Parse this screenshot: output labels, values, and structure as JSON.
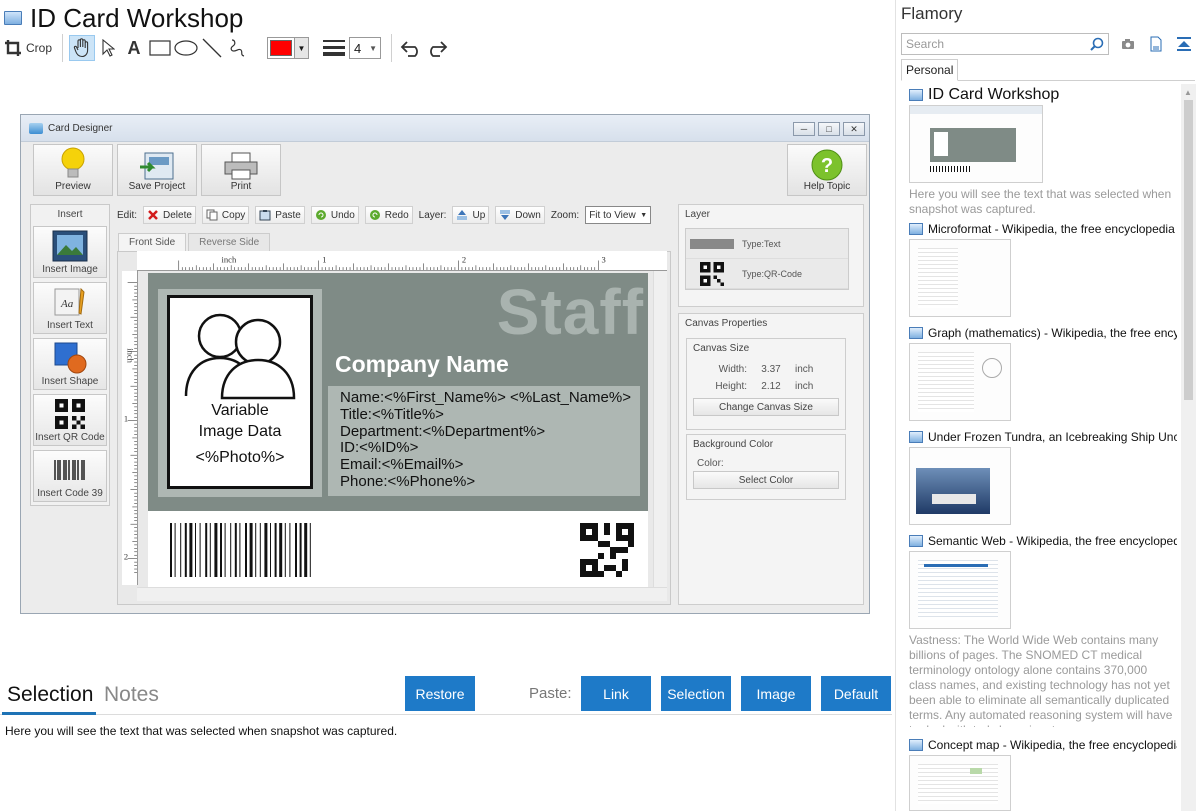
{
  "window": {
    "title": "ID Card Workshop"
  },
  "toolbar": {
    "crop_label": "Crop",
    "line_width": "4"
  },
  "snapshot": {
    "title": "Card Designer",
    "buttons": {
      "preview": "Preview",
      "save": "Save Project",
      "print": "Print",
      "help": "Help Topic"
    },
    "insert": {
      "header": "Insert",
      "items": [
        "Insert Image",
        "Insert Text",
        "Insert Shape",
        "Insert QR Code",
        "Insert Code 39"
      ]
    },
    "edit_bar": {
      "edit_label": "Edit:",
      "delete": "Delete",
      "copy": "Copy",
      "paste": "Paste",
      "undo": "Undo",
      "redo": "Redo",
      "layer_label": "Layer:",
      "up": "Up",
      "down": "Down",
      "zoom_label": "Zoom:",
      "zoom_value": "Fit to View"
    },
    "tabs": [
      "Front Side",
      "Reverse Side"
    ],
    "ruler": {
      "unit": "inch",
      "h_marks": [
        "1",
        "2",
        "3"
      ],
      "v_marks": [
        "1",
        "2"
      ]
    },
    "card": {
      "watermark": "Staff",
      "company": "Company Name",
      "photo": [
        "Variable",
        "Image Data",
        "<%Photo%>"
      ],
      "fields": [
        "Name:<%First_Name%> <%Last_Name%>",
        "Title:<%Title%>",
        "Department:<%Department%>",
        "ID:<%ID%>",
        "Email:<%Email%>",
        "Phone:<%Phone%>"
      ]
    },
    "layer": {
      "header": "Layer",
      "rows": [
        "Type:Text",
        "Type:QR-Code"
      ]
    },
    "canvas_props": {
      "header": "Canvas Properties",
      "size_header": "Canvas Size",
      "width_label": "Width:",
      "width_value": "3.37",
      "width_unit": "inch",
      "height_label": "Height:",
      "height_value": "2.12",
      "height_unit": "inch",
      "change_btn": "Change Canvas Size",
      "bg_header": "Background Color",
      "color_label": "Color:",
      "select_btn": "Select Color"
    }
  },
  "bottom": {
    "tabs": [
      "Selection",
      "Notes"
    ],
    "restore": "Restore",
    "paste_label": "Paste:",
    "paste_buttons": [
      "Link",
      "Selection",
      "Image",
      "Default"
    ],
    "selection_text": "Here you will see the text that was selected when snapshot was captured."
  },
  "flamory": {
    "title": "Flamory",
    "search_placeholder": "Search",
    "tab": "Personal",
    "items": [
      {
        "title": "ID Card Workshop",
        "desc": "Here you will see the text that was selected when snapshot was captured."
      },
      {
        "title": "Microformat - Wikipedia, the free encyclopedia",
        "desc": ""
      },
      {
        "title": "Graph (mathematics) - Wikipedia, the free encyclopedia",
        "desc": ""
      },
      {
        "title": "Under Frozen Tundra, an Icebreaking Ship Uncovers",
        "desc": ""
      },
      {
        "title": "Semantic Web - Wikipedia, the free encyclopedia",
        "desc": "Vastness: The World Wide Web contains many billions of pages. The SNOMED CT medical terminology ontology alone contains 370,000 class names, and existing technology has not yet been able to eliminate all semantically duplicated terms. Any automated reasoning system will have to deal with truly huge inputs."
      },
      {
        "title": "Concept map - Wikipedia, the free encyclopedia",
        "desc": ""
      }
    ]
  },
  "colors": {
    "accent": "#1e7ac8",
    "draw_color": "#ff0000",
    "card_bg": "#7f8b86"
  }
}
